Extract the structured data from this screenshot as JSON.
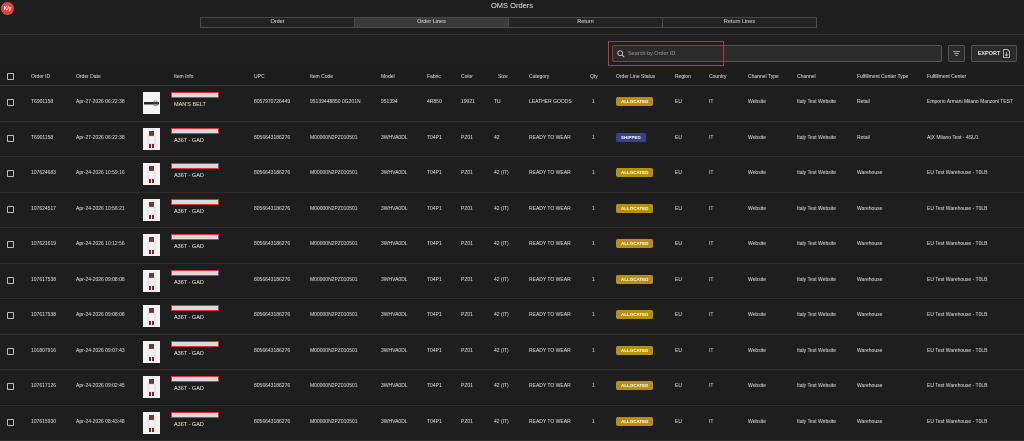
{
  "header": {
    "logo_text": "K/y",
    "title": "OMS Orders"
  },
  "tabs": [
    {
      "label": "Order",
      "active": false
    },
    {
      "label": "Order Lines",
      "active": true
    },
    {
      "label": "Return",
      "active": false
    },
    {
      "label": "Return Lines",
      "active": false
    }
  ],
  "toolbar": {
    "search_placeholder": "Search by Order ID",
    "export_label": "EXPORT"
  },
  "columns": [
    "Order ID",
    "Order Date",
    "Item Info",
    "UPC",
    "Item Code",
    "Model",
    "Fabric",
    "Color",
    "Size",
    "Category",
    "Qty",
    "Order Line Status",
    "Region",
    "Country",
    "Channel Type",
    "Channel",
    "Fulfillment Center Type",
    "Fulfillment Center"
  ],
  "rows": [
    {
      "order_id": "T6901158",
      "order_date": "Apr-27-2026 06:22:38",
      "item_name": "MAN'S BELT",
      "thumb": "belt",
      "upc": "8057970726449",
      "item_code": "95139448850 0G201N",
      "model": "951394",
      "fabric": "4R850",
      "color": "19921",
      "size": "TU",
      "category": "LEATHER GOODS",
      "qty": "1",
      "status": "ALLOCATED",
      "region": "EU",
      "country": "IT",
      "channel_type": "Website",
      "channel": "Italy Test Website",
      "fc_type": "Retail",
      "fc": "Emporio Armani Milano Manzoni TEST"
    },
    {
      "order_id": "T6901158",
      "order_date": "Apr-27-2026 06:22:38",
      "item_name": "A36T - GAD",
      "thumb": "garment",
      "upc": "8056643186276",
      "item_code": "M00000N2PZ010501",
      "model": "3WHVA0DL",
      "fabric": "T04P1",
      "color": "PZ01",
      "size": "42",
      "category": "READY TO WEAR",
      "qty": "1",
      "status": "SHIPPED",
      "region": "EU",
      "country": "IT",
      "channel_type": "Website",
      "channel": "Italy Test Website",
      "fc_type": "Retail",
      "fc": "A|X Milano Test - 4SU1"
    },
    {
      "order_id": "107624683",
      "order_date": "Apr-24-2026 10:59:16",
      "item_name": "A36T - GAD",
      "thumb": "garment",
      "upc": "8056643186276",
      "item_code": "M00000N2PZ010501",
      "model": "3WHVA0DL",
      "fabric": "T04P1",
      "color": "PZ01",
      "size": "42 (IT)",
      "category": "READY TO WEAR",
      "qty": "1",
      "status": "ALLOCATED",
      "region": "EU",
      "country": "IT",
      "channel_type": "Website",
      "channel": "Italy Test Website",
      "fc_type": "Warehouse",
      "fc": "EU Test Warehouse - T0LB"
    },
    {
      "order_id": "107624517",
      "order_date": "Apr-24-2026 10:56:21",
      "item_name": "A36T - GAD",
      "thumb": "garment",
      "upc": "8056643186276",
      "item_code": "M00000N2PZ010501",
      "model": "3WHVA0DL",
      "fabric": "T04P1",
      "color": "PZ01",
      "size": "42 (IT)",
      "category": "READY TO WEAR",
      "qty": "1",
      "status": "ALLOCATED",
      "region": "EU",
      "country": "IT",
      "channel_type": "Website",
      "channel": "Italy Test Website",
      "fc_type": "Warehouse",
      "fc": "EU Test Warehouse - T0LB"
    },
    {
      "order_id": "107621619",
      "order_date": "Apr-24-2026 10:12:56",
      "item_name": "A36T - GAD",
      "thumb": "garment",
      "upc": "8056643186276",
      "item_code": "M00000N2PZ010501",
      "model": "3WHVA0DL",
      "fabric": "T04P1",
      "color": "PZ01",
      "size": "42 (IT)",
      "category": "READY TO WEAR",
      "qty": "1",
      "status": "ALLOCATED",
      "region": "EU",
      "country": "IT",
      "channel_type": "Website",
      "channel": "Italy Test Website",
      "fc_type": "Warehouse",
      "fc": "EU Test Warehouse - T0LB"
    },
    {
      "order_id": "107617538",
      "order_date": "Apr-24-2026 09:08:08",
      "item_name": "A36T - GAD",
      "thumb": "garment",
      "upc": "8056643186276",
      "item_code": "M00000N2PZ010501",
      "model": "3WHVA0DL",
      "fabric": "T04P1",
      "color": "PZ01",
      "size": "42 (IT)",
      "category": "READY TO WEAR",
      "qty": "1",
      "status": "ALLOCATED",
      "region": "EU",
      "country": "IT",
      "channel_type": "Website",
      "channel": "Italy Test Website",
      "fc_type": "Warehouse",
      "fc": "EU Test Warehouse - T0LB"
    },
    {
      "order_id": "107617538",
      "order_date": "Apr-24-2026 09:08:08",
      "item_name": "A36T - GAD",
      "thumb": "garment",
      "upc": "8056643186276",
      "item_code": "M00000N2PZ010501",
      "model": "3WHVA0DL",
      "fabric": "T04P1",
      "color": "PZ01",
      "size": "42 (IT)",
      "category": "READY TO WEAR",
      "qty": "1",
      "status": "ALLOCATED",
      "region": "EU",
      "country": "IT",
      "channel_type": "Website",
      "channel": "Italy Test Website",
      "fc_type": "Warehouse",
      "fc": "EU Test Warehouse - T0LB"
    },
    {
      "order_id": "101807916",
      "order_date": "Apr-24-2026 09:07:43",
      "item_name": "A36T - GAD",
      "thumb": "garment",
      "upc": "8056643186276",
      "item_code": "M00000N2PZ010501",
      "model": "3WHVA0DL",
      "fabric": "T04P1",
      "color": "PZ01",
      "size": "42 (IT)",
      "category": "READY TO WEAR",
      "qty": "1",
      "status": "ALLOCATED",
      "region": "EU",
      "country": "IT",
      "channel_type": "Website",
      "channel": "Italy Test Website",
      "fc_type": "Warehouse",
      "fc": "EU Test Warehouse - T0LB"
    },
    {
      "order_id": "107617126",
      "order_date": "Apr-24-2026 09:02:45",
      "item_name": "A36T - GAD",
      "thumb": "garment",
      "upc": "8056643186276",
      "item_code": "M00000N2PZ010501",
      "model": "3WHVA0DL",
      "fabric": "T04P1",
      "color": "PZ01",
      "size": "42 (IT)",
      "category": "READY TO WEAR",
      "qty": "1",
      "status": "ALLOCATED",
      "region": "EU",
      "country": "IT",
      "channel_type": "Website",
      "channel": "Italy Test Website",
      "fc_type": "Warehouse",
      "fc": "EU Test Warehouse - T0LB"
    },
    {
      "order_id": "107615930",
      "order_date": "Apr-24-2026 08:43:48",
      "item_name": "A36T - GAD",
      "thumb": "garment",
      "upc": "8056643186276",
      "item_code": "M00000N2PZ010501",
      "model": "3WHVA0DL",
      "fabric": "T04P1",
      "color": "PZ01",
      "size": "42 (IT)",
      "category": "READY TO WEAR",
      "qty": "1",
      "status": "ALLOCATED",
      "region": "EU",
      "country": "IT",
      "channel_type": "Website",
      "channel": "Italy Test Website",
      "fc_type": "Warehouse",
      "fc": "EU Test Warehouse - T0LB"
    }
  ],
  "colors": {
    "allocated": "#b8900f",
    "shipped": "#3e3f8c",
    "highlight": "#d32f2f"
  }
}
